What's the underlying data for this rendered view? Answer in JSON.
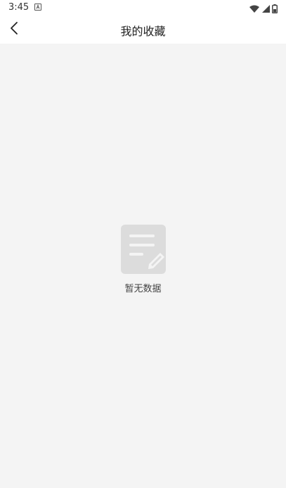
{
  "status_bar": {
    "time": "3:45",
    "icons": [
      "notification-a-icon",
      "wifi-icon",
      "signal-icon",
      "battery-icon"
    ]
  },
  "nav": {
    "back_icon": "chevron-left-icon",
    "title": "我的收藏"
  },
  "empty_state": {
    "icon": "empty-note-icon",
    "text": "暂无数据"
  },
  "colors": {
    "background": "#f4f4f4",
    "bar": "#ffffff",
    "icon_gray": "#dcdcdc"
  }
}
